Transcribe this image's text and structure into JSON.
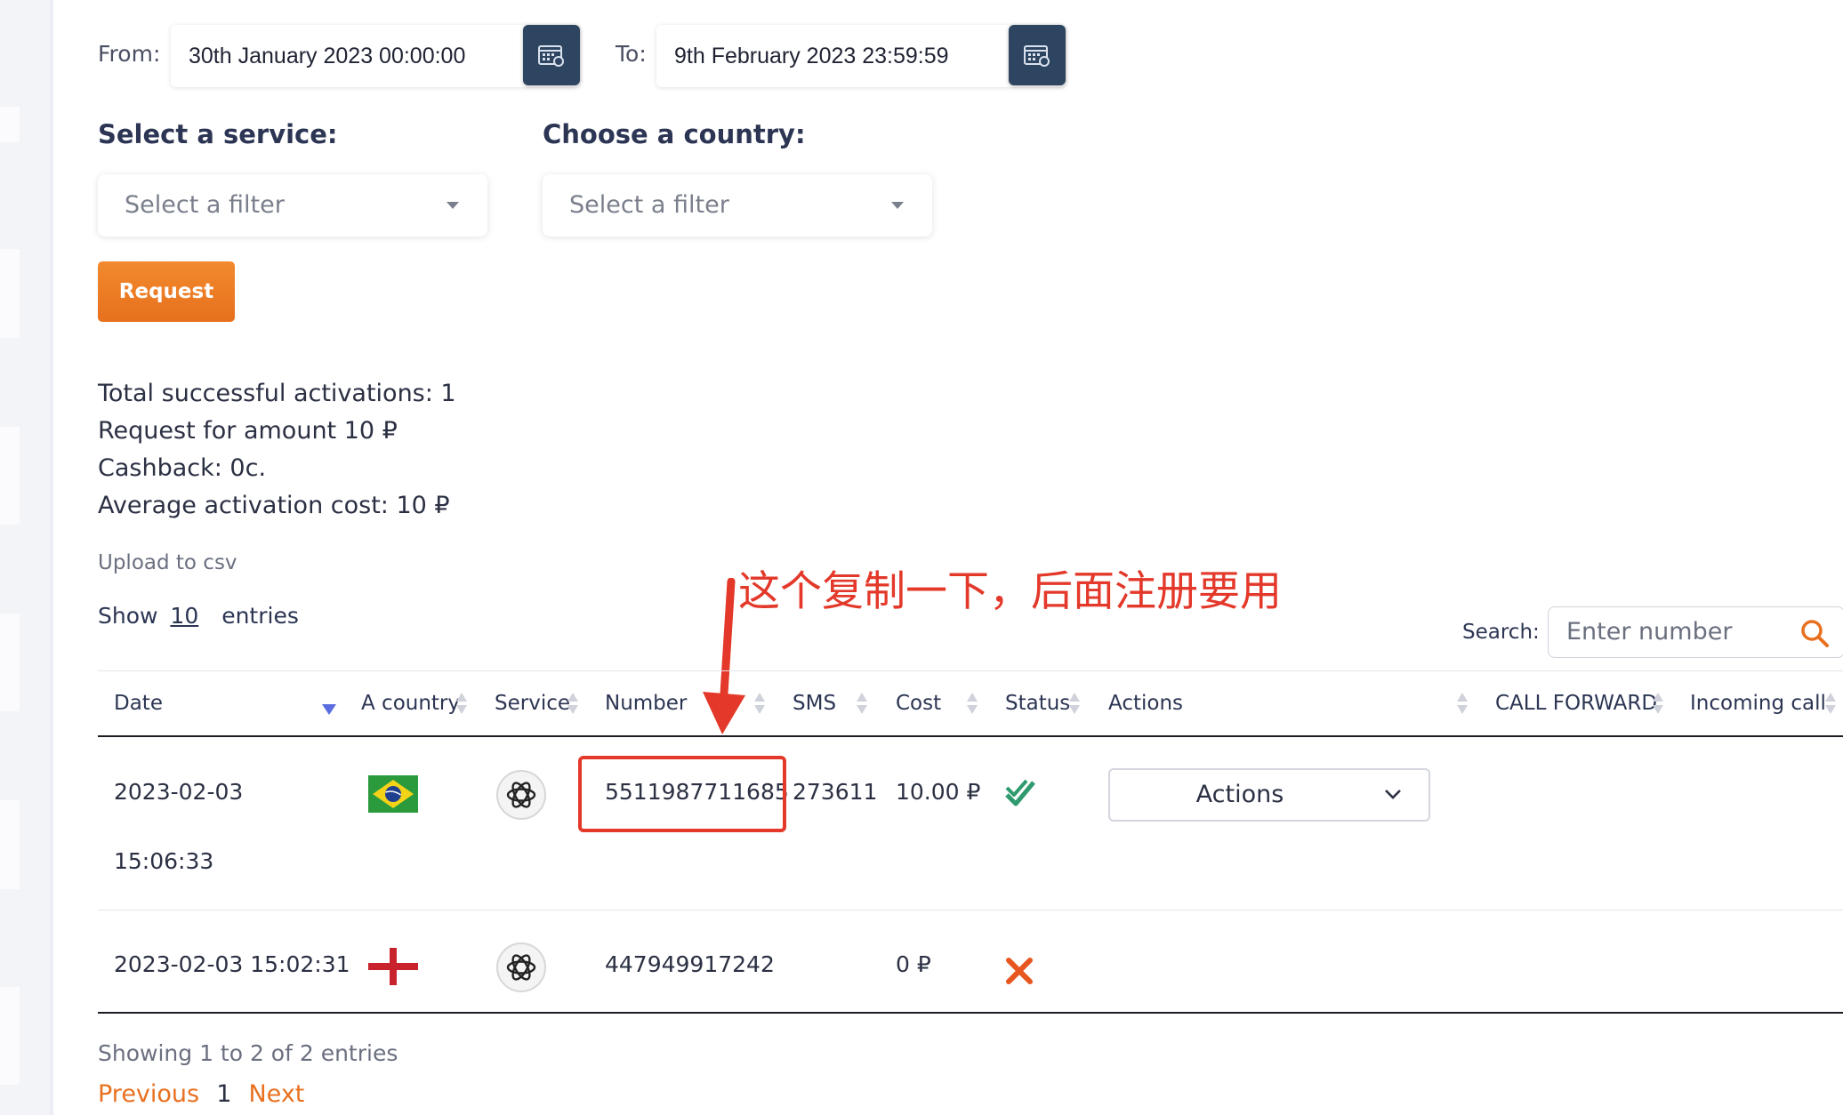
{
  "filters": {
    "from_label": "From:",
    "from_value": "30th January 2023 00:00:00",
    "to_label": "To:",
    "to_value": "9th February 2023 23:59:59",
    "service_title": "Select a service:",
    "service_placeholder": "Select a filter",
    "country_title": "Choose a country:",
    "country_placeholder": "Select a filter",
    "request_label": "Request"
  },
  "stats": {
    "total": "Total successful activations: 1",
    "amount": "Request for amount 10 ₽",
    "cashback": "Cashback: 0c.",
    "average": "Average activation cost: 10 ₽"
  },
  "upload_label": "Upload to csv",
  "length": {
    "show": "Show",
    "value": "10",
    "entries": "entries"
  },
  "annotation": "这个复制一下，后面注册要用",
  "search": {
    "label": "Search:",
    "placeholder": "Enter number"
  },
  "table": {
    "headers": [
      "Date",
      "A country",
      "Service",
      "Number",
      "SMS",
      "Cost",
      "Status",
      "Actions",
      "CALL FORWARD",
      "Incoming call"
    ],
    "rows": [
      {
        "date": "2023-02-03",
        "time": "15:06:33",
        "country_icon": "brazil-flag",
        "service_icon": "openai-icon",
        "number": "5511987711685",
        "sms": "273611",
        "cost": "10.00 ₽",
        "status_icon": "check-icon",
        "actions_label": "Actions"
      },
      {
        "date": "2023-02-03 15:02:31",
        "country_icon": "england-flag",
        "service_icon": "openai-icon",
        "number": "447949917242",
        "sms": "",
        "cost": "0 ₽",
        "status_icon": "cross-icon"
      }
    ]
  },
  "footer": {
    "info": "Showing 1 to 2 of 2 entries",
    "previous": "Previous",
    "page": "1",
    "next": "Next"
  },
  "colors": {
    "accent": "#e8701f",
    "calendar_button": "#2e4561",
    "annotation_red": "#e3382a",
    "success_green": "#2e9a6e"
  }
}
